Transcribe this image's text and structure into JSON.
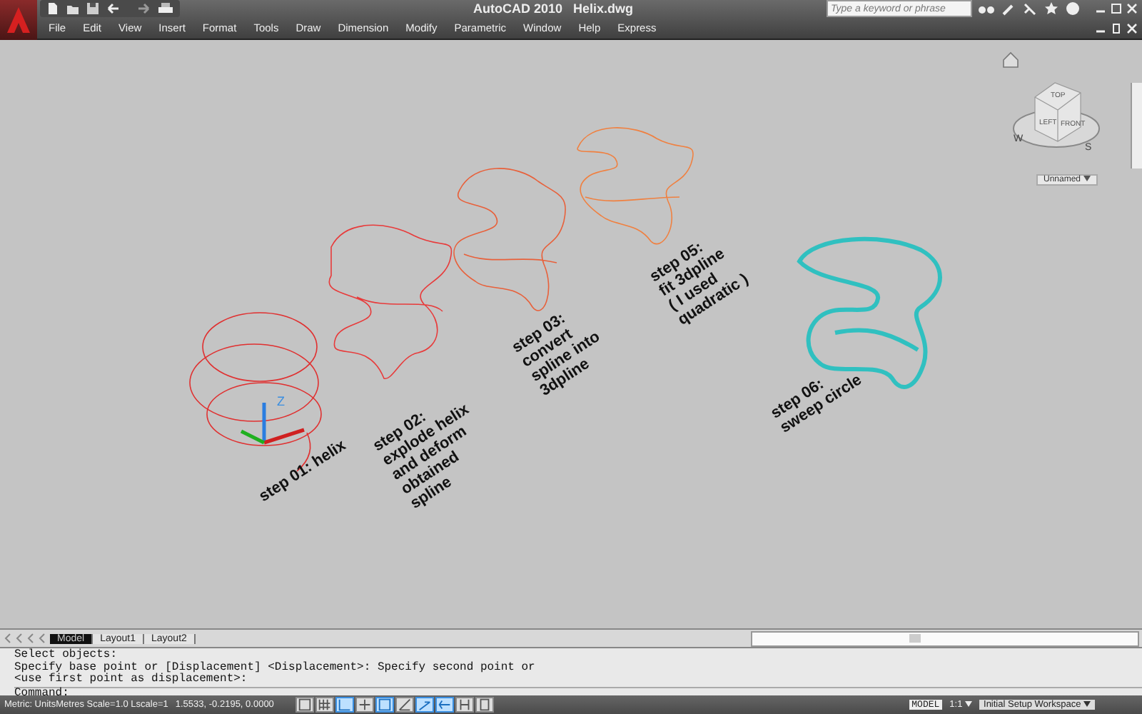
{
  "title_bar": {
    "app": "AutoCAD 2010",
    "file": "Helix.dwg",
    "search": {
      "placeholder": "Type a keyword or phrase"
    }
  },
  "menu": [
    "File",
    "Edit",
    "View",
    "Insert",
    "Format",
    "Tools",
    "Draw",
    "Dimension",
    "Modify",
    "Parametric",
    "Window",
    "Help",
    "Express"
  ],
  "viewcube": {
    "faces": [
      "TOP",
      "LEFT",
      "FRONT"
    ],
    "compass": [
      "W",
      "S"
    ],
    "view_name": "Unnamed"
  },
  "ucs": {
    "axis": "Z"
  },
  "annotations": [
    {
      "text": "step 01: helix"
    },
    {
      "text": "step 02:\nexplode helix\nand deform\nobtained\nspline"
    },
    {
      "text": "step 03:\nconvert\nspline into\n3dpline"
    },
    {
      "text": "step 05:\nfit 3dpline\n( I used\nquadratic )"
    },
    {
      "text": "step 06:\nsweep circle"
    }
  ],
  "layout_tabs": [
    {
      "label": "Model",
      "selected": true
    },
    {
      "label": "Layout1",
      "selected": false
    },
    {
      "label": "Layout2",
      "selected": false
    }
  ],
  "command_history": [
    "Select objects:",
    "Specify base point or [Displacement] <Displacement>: Specify second point or",
    "<use first point as displacement>:"
  ],
  "command_prompt": "Command:",
  "status_bar": {
    "units": "Metric: UnitsMetres Scale=1.0 Lscale=1",
    "coordinates": "1.5533, -0.2195, 0.0000",
    "toggles": [
      {
        "on": false
      },
      {
        "on": false
      },
      {
        "on": true
      },
      {
        "on": false
      },
      {
        "on": true
      },
      {
        "on": false
      },
      {
        "on": true
      },
      {
        "on": true
      },
      {
        "on": false
      },
      {
        "on": false
      }
    ],
    "model": "MODEL",
    "annotation_scale": "1:1",
    "workspace": "Initial Setup Workspace"
  }
}
